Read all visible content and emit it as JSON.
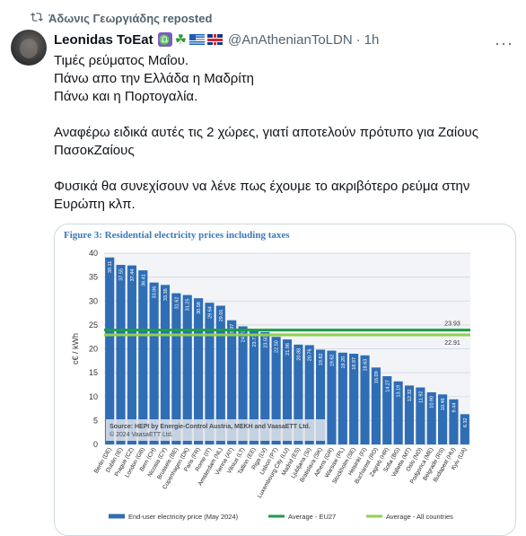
{
  "repost": {
    "text": "Άδωνις Γεωργιάδης reposted",
    "icon": "repost-icon"
  },
  "tweet": {
    "name": "Leonidas ToEat",
    "handle": "@AnAthenianToLDN",
    "time": "1h",
    "more": "···",
    "lines": [
      "Τιμές ρεύματος Μαΐου.",
      "Πάνω απο την Ελλάδα η Μαδρίτη",
      "Πάνω και η Πορτογαλία.",
      "",
      "Αναφέρω ειδικά αυτές τις 2 χώρες, γιατί αποτελούν πρότυπο για Ζαίους",
      "ΠασοκΖαίους",
      "",
      "Φυσικά θα συνεχίσουν να λένε πως έχουμε το ακριβότερο ρεύμα στην",
      "Ευρώπη κλπ."
    ]
  },
  "chart_data": {
    "type": "bar",
    "title": "Figure 3: Residential electricity prices including taxes",
    "ylabel": "c€ / kWh",
    "ylim": [
      0,
      40
    ],
    "yticks": [
      0,
      5,
      10,
      15,
      20,
      25,
      30,
      35,
      40
    ],
    "categories": [
      "Berlin (DE)",
      "Dublin (IE)",
      "Prague (CZ)",
      "London (GB)",
      "Bern (CH)",
      "Nicosia (CY)",
      "Brussels (BE)",
      "Copenhagen (DK)",
      "Paris (FR)",
      "Rome (IT)",
      "Amsterdam (NL)",
      "Vienna (AT)",
      "Vilnius (LT)",
      "Tallinn (EE)",
      "Riga (LV)",
      "Lisbon (PT)",
      "Luxembourg City (LU)",
      "Madrid (ES)",
      "Ljubljana (SI)",
      "Bratislava (SK)",
      "Athens (GR)",
      "Warsaw (PL)",
      "Stockholm (SE)",
      "Helsinki (FI)",
      "Bucharest (RO)",
      "Zagreb (HR)",
      "Sofia (BG)",
      "Valletta (MT)",
      "Oslo (NO)",
      "Podgorica (ME)",
      "Belgrade (RS)",
      "Budapest (HU)",
      "Kyiv (UA)"
    ],
    "values": [
      39.11,
      37.55,
      37.44,
      36.41,
      33.86,
      33.36,
      31.62,
      31.25,
      30.58,
      29.64,
      29.01,
      25.97,
      24.7,
      23.71,
      23.5,
      22.5,
      21.96,
      20.88,
      20.76,
      19.82,
      19.62,
      19.2,
      18.97,
      18.63,
      16.09,
      14.27,
      13.19,
      12.32,
      11.92,
      10.9,
      10.46,
      9.44,
      6.32
    ],
    "series": [
      {
        "name": "End-user electricity price (May 2024)",
        "color": "#2f6db5"
      }
    ],
    "lines": [
      {
        "name": "Average - EU27",
        "value": 23.93,
        "color": "#1e9e49"
      },
      {
        "name": "Average - All countries",
        "value": 22.91,
        "color": "#8fd14f"
      }
    ],
    "source": "Source: HEPI by Energie-Control Austria, MEKH and VaasaETT Ltd.",
    "copyright": "© 2024 VaasaETT Ltd.",
    "grid": true,
    "legend_position": "bottom"
  }
}
